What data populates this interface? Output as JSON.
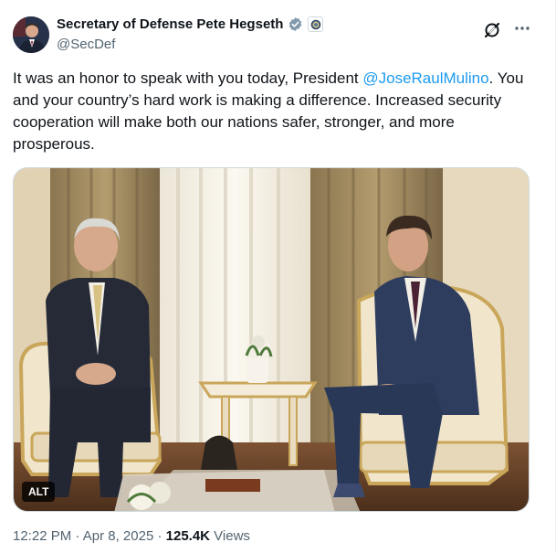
{
  "author": {
    "name": "Secretary of Defense Pete Hegseth",
    "handle": "@SecDef"
  },
  "tweet": {
    "text_before": "It was an honor to speak with you today, President ",
    "mention": "@JoseRaulMulino",
    "text_after": ". You and your country’s hard work is making a difference. Increased security cooperation will make both our nations safer, stronger, and more prosperous."
  },
  "media": {
    "alt_label": "ALT"
  },
  "meta": {
    "time": "12:22 PM",
    "sep1": " · ",
    "date": "Apr 8, 2025",
    "sep2": " · ",
    "views": "125.4K",
    "views_label": " Views"
  },
  "icons": [
    "verified-badge-icon",
    "government-affiliation-icon",
    "grok-icon",
    "more-options-icon"
  ],
  "colors": {
    "link": "#1d9bf0",
    "verified": "#829aab",
    "muted": "#536471"
  }
}
